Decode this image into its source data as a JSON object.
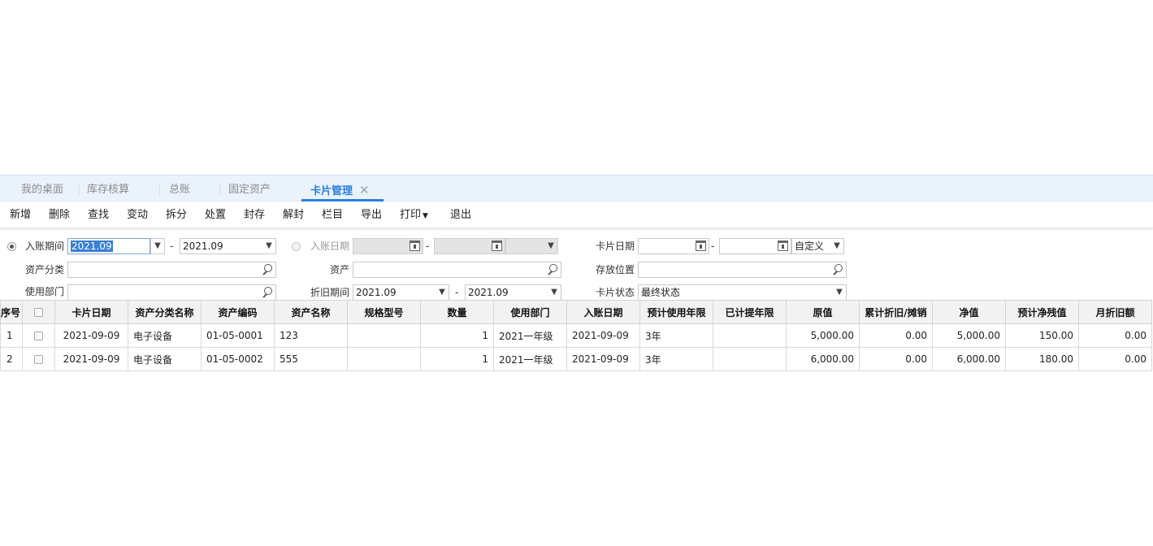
{
  "tabs": [
    {
      "label": "我的桌面"
    },
    {
      "label": "库存核算"
    },
    {
      "label": "总账"
    },
    {
      "label": "固定资产"
    },
    {
      "label": "卡片管理",
      "active": true,
      "close": "✕"
    }
  ],
  "toolbar": {
    "add": "新增",
    "delete": "删除",
    "find": "查找",
    "change": "变动",
    "split": "拆分",
    "dispose": "处置",
    "seal": "封存",
    "unseal": "解封",
    "columns": "栏目",
    "export": "导出",
    "print": "打印",
    "exit": "退出"
  },
  "filters": {
    "posting_period_label": "入账期间",
    "posting_period_from": "2021.09",
    "posting_period_to": "2021.09",
    "posting_date_label": "入账日期",
    "card_date_label": "卡片日期",
    "card_date_range": "自定义",
    "asset_category_label": "资产分类",
    "asset_label": "资产",
    "location_label": "存放位置",
    "department_label": "使用部门",
    "depreciation_period_label": "折旧期间",
    "depreciation_period_from": "2021.09",
    "depreciation_period_to": "2021.09",
    "card_status_label": "卡片状态",
    "card_status_value": "最终状态",
    "dash": "-"
  },
  "table": {
    "columns": [
      "序号",
      "",
      "卡片日期",
      "资产分类名称",
      "资产编码",
      "资产名称",
      "规格型号",
      "数量",
      "使用部门",
      "入账日期",
      "预计使用年限",
      "已计提年限",
      "原值",
      "累计折旧/摊销",
      "净值",
      "预计净残值",
      "月折旧额"
    ],
    "rows": [
      [
        "1",
        "",
        "2021-09-09",
        "电子设备",
        "01-05-0001",
        "123",
        "",
        "1",
        "2021一年级",
        "2021-09-09",
        "3年",
        "",
        "5,000.00",
        "0.00",
        "5,000.00",
        "150.00",
        "0.00"
      ],
      [
        "2",
        "",
        "2021-09-09",
        "电子设备",
        "01-05-0002",
        "555",
        "",
        "1",
        "2021一年级",
        "2021-09-09",
        "3年",
        "",
        "6,000.00",
        "0.00",
        "6,000.00",
        "180.00",
        "0.00"
      ]
    ]
  },
  "colors": {
    "accent": "#2a7ee0",
    "tabbar_bg": "#eaf2fb",
    "header_bg": "#f2f2f2"
  }
}
